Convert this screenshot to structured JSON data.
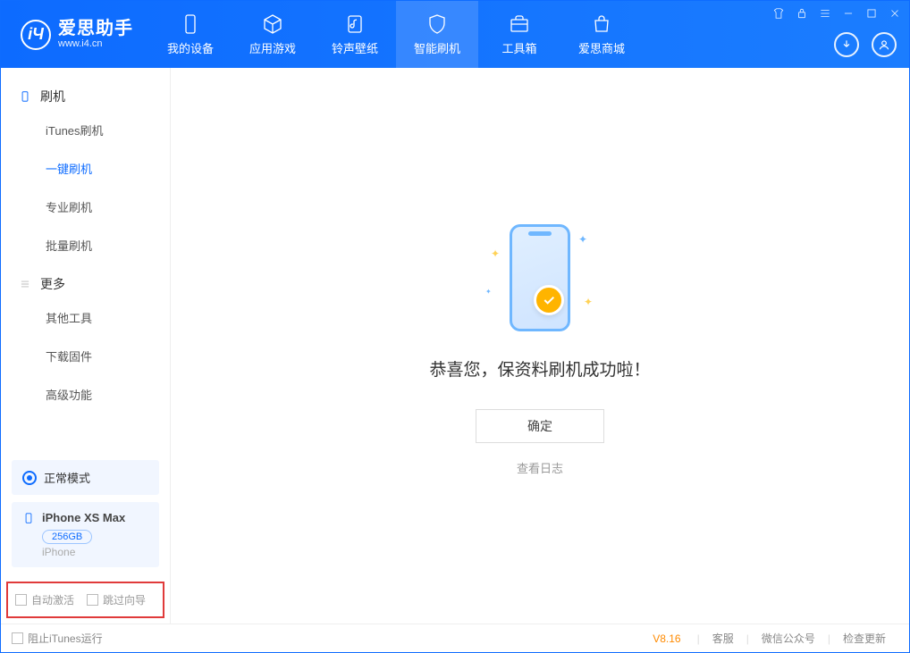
{
  "logo": {
    "title": "爱思助手",
    "subtitle": "www.i4.cn",
    "glyph": "iЧ"
  },
  "nav": {
    "device": "我的设备",
    "apps": "应用游戏",
    "ringtones": "铃声壁纸",
    "flash": "智能刷机",
    "toolbox": "工具箱",
    "store": "爱思商城"
  },
  "sidebar": {
    "group_flash": "刷机",
    "items_flash": {
      "itunes": "iTunes刷机",
      "oneclick": "一键刷机",
      "pro": "专业刷机",
      "batch": "批量刷机"
    },
    "group_more": "更多",
    "items_more": {
      "other": "其他工具",
      "firmware": "下载固件",
      "advanced": "高级功能"
    }
  },
  "mode": {
    "label": "正常模式"
  },
  "device": {
    "name": "iPhone XS Max",
    "capacity": "256GB",
    "type": "iPhone"
  },
  "checks": {
    "auto_activate": "自动激活",
    "skip_guide": "跳过向导"
  },
  "main": {
    "success": "恭喜您，保资料刷机成功啦！",
    "ok": "确定",
    "log": "查看日志"
  },
  "footer": {
    "block_itunes": "阻止iTunes运行",
    "version": "V8.16",
    "support": "客服",
    "wechat": "微信公众号",
    "update": "检查更新"
  }
}
